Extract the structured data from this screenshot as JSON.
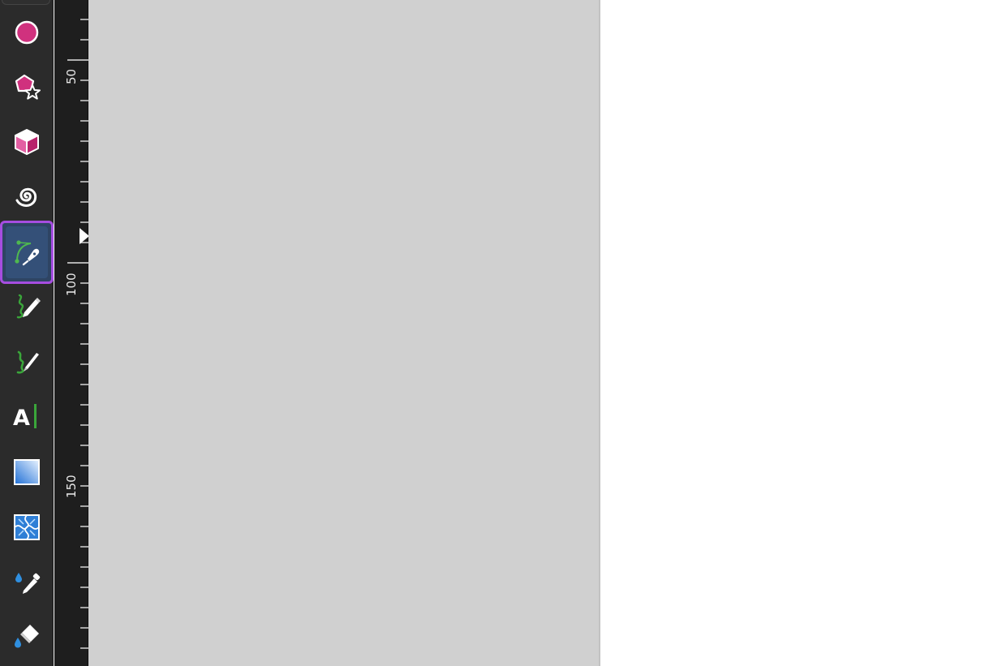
{
  "toolbox": {
    "tools": [
      {
        "name": "ellipse-tool",
        "icon": "circle-icon",
        "active": false
      },
      {
        "name": "star-polygon-tool",
        "icon": "star-polygon-icon",
        "active": false
      },
      {
        "name": "3d-box-tool",
        "icon": "cube-icon",
        "active": false
      },
      {
        "name": "spiral-tool",
        "icon": "spiral-icon",
        "active": false
      },
      {
        "name": "pen-tool",
        "icon": "pen-bezier-icon",
        "active": true
      },
      {
        "name": "pencil-tool",
        "icon": "pencil-icon",
        "active": false
      },
      {
        "name": "calligraphy-tool",
        "icon": "calligraphy-icon",
        "active": false
      },
      {
        "name": "text-tool",
        "icon": "text-icon",
        "active": false
      },
      {
        "name": "gradient-tool",
        "icon": "gradient-icon",
        "active": false
      },
      {
        "name": "mesh-tool",
        "icon": "mesh-icon",
        "active": false
      },
      {
        "name": "dropper-tool",
        "icon": "dropper-icon",
        "active": false
      },
      {
        "name": "paint-bucket-tool",
        "icon": "paint-bucket-icon",
        "active": false
      }
    ],
    "text_tool_glyph": "A"
  },
  "ruler": {
    "labels": [
      "50",
      "100",
      "150"
    ]
  },
  "colors": {
    "toolbox_bg": "#2b2b2b",
    "ruler_bg": "#1e1e1e",
    "canvas_bg": "#d0d0d0",
    "page_bg": "#ffffff",
    "active_tool_border": "#a64de0",
    "active_tool_bg": "#345078",
    "shape_tool_pink": "#d63384",
    "path_tool_green": "#3aa63a",
    "paint_tool_blue": "#2f8fe0"
  }
}
